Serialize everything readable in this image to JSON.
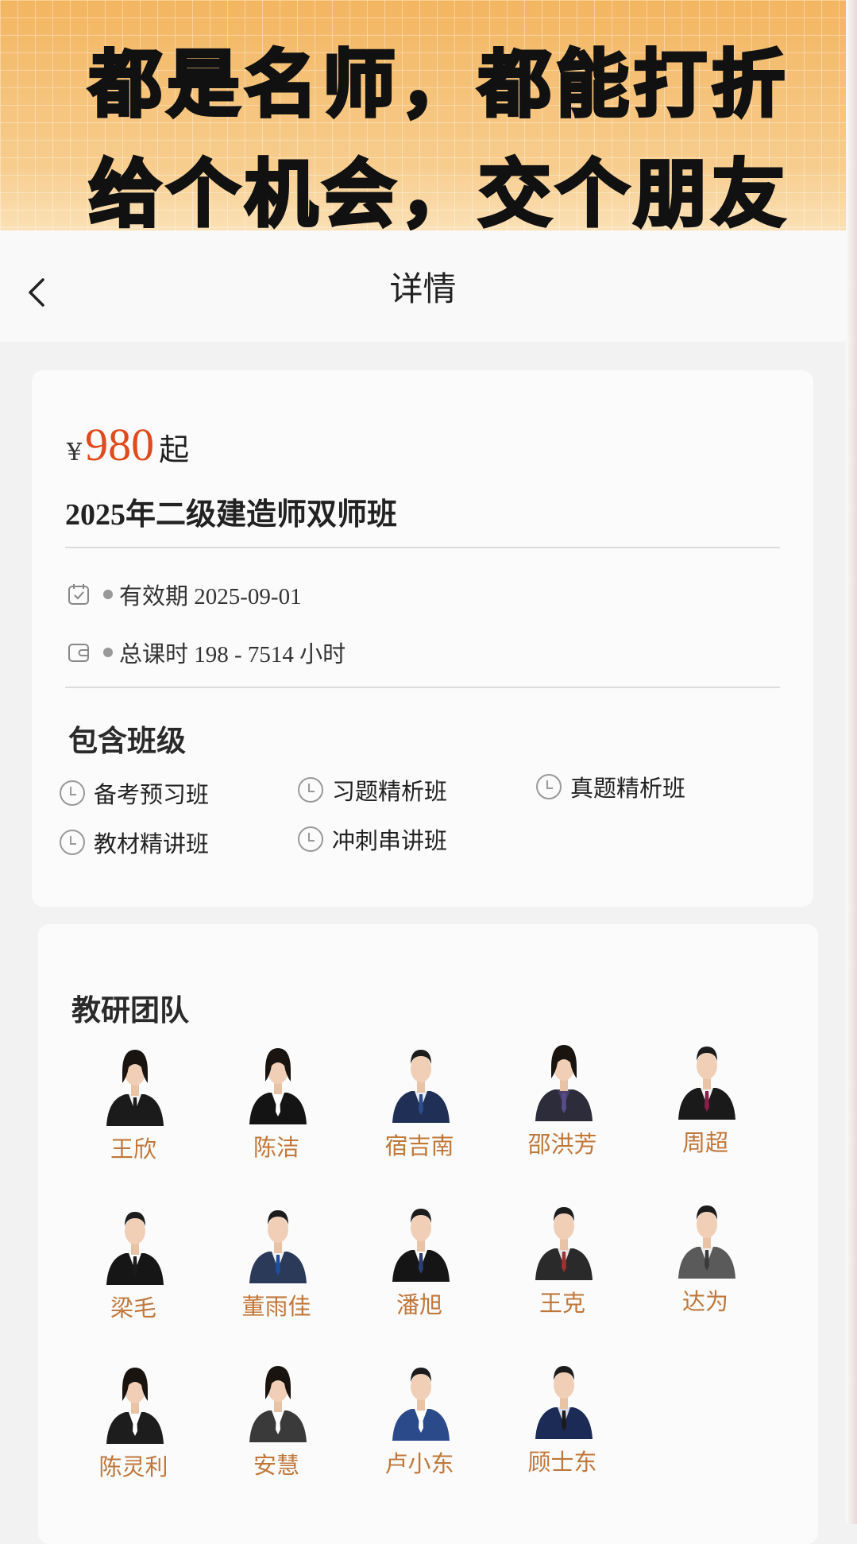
{
  "banner": {
    "line1": "都是名师，都能打折",
    "line2": "给个机会，交个朋友"
  },
  "nav": {
    "title": "详情"
  },
  "course": {
    "currency": "¥",
    "price": "980",
    "price_suffix": "起",
    "title": "2025年二级建造师双师班",
    "validity": "有效期 2025-09-01",
    "hours": "总课时 198 - 7514 小时"
  },
  "classes": {
    "title": "包含班级",
    "items": [
      "备考预习班",
      "习题精析班",
      "真题精析班",
      "教材精讲班",
      "冲刺串讲班"
    ]
  },
  "team": {
    "title": "教研团队",
    "teachers": [
      {
        "name": "王欣",
        "suit": "#1b1b1b",
        "tie": "#1b1b1b",
        "shirt": "#f2f2f2",
        "gender": "f"
      },
      {
        "name": "陈洁",
        "suit": "#141414",
        "tie": "#ffffff",
        "shirt": "#ffffff",
        "gender": "f"
      },
      {
        "name": "宿吉南",
        "suit": "#1f2f55",
        "tie": "#2b4d8a",
        "shirt": "#e8eef8",
        "gender": "m"
      },
      {
        "name": "邵洪芳",
        "suit": "#2c2c3a",
        "tie": "#5a4c8a",
        "shirt": "#4b3f6b",
        "gender": "f"
      },
      {
        "name": "周超",
        "suit": "#1a1a1a",
        "tie": "#8a1d4a",
        "shirt": "#f2f2f2",
        "gender": "m"
      },
      {
        "name": "梁毛",
        "suit": "#161616",
        "tie": "#1a1a1a",
        "shirt": "#ffffff",
        "gender": "m"
      },
      {
        "name": "董雨佳",
        "suit": "#2c3a5a",
        "tie": "#1e4ea0",
        "shirt": "#f4f4f4",
        "gender": "m"
      },
      {
        "name": "潘旭",
        "suit": "#151515",
        "tie": "#2a3c70",
        "shirt": "#ffffff",
        "gender": "m"
      },
      {
        "name": "王克",
        "suit": "#2a2a2a",
        "tie": "#a03030",
        "shirt": "#e6e6e6",
        "gender": "m"
      },
      {
        "name": "达为",
        "suit": "#5a5a5a",
        "tie": "#3a3a3a",
        "shirt": "#f0f0f0",
        "gender": "m"
      },
      {
        "name": "陈灵利",
        "suit": "#1d1d1d",
        "tie": "#ffffff",
        "shirt": "#ffffff",
        "gender": "f"
      },
      {
        "name": "安慧",
        "suit": "#3a3a3a",
        "tie": "#ffffff",
        "shirt": "#ffffff",
        "gender": "f"
      },
      {
        "name": "卢小东",
        "suit": "#2a4a8a",
        "tie": "#ffffff",
        "shirt": "#ffffff",
        "gender": "m"
      },
      {
        "name": "顾士东",
        "suit": "#1b2b55",
        "tie": "#1b1b1b",
        "shirt": "#d8dde8",
        "gender": "m"
      }
    ]
  },
  "colors": {
    "price": "#e04a1c",
    "teacher_name": "#c0773a",
    "banner_top": "#f3b560"
  }
}
